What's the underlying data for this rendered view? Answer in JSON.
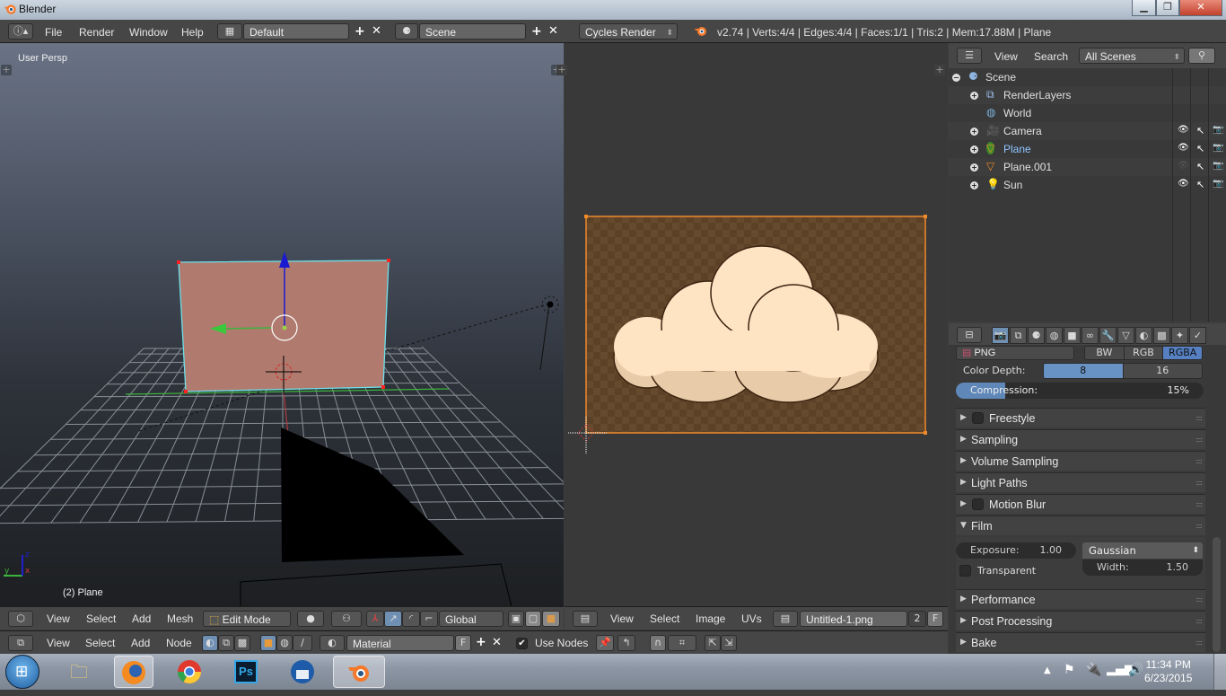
{
  "window": {
    "title": "Blender",
    "minimize_icon": "minimize-icon",
    "restore_icon": "restore-icon",
    "close_icon": "close-icon"
  },
  "info_header": {
    "menus": [
      "File",
      "Render",
      "Window",
      "Help"
    ],
    "screen_layout": "Default",
    "scene": "Scene",
    "render_engine": "Cycles Render",
    "stats": "v2.74 | Verts:4/4 | Edges:4/4 | Faces:1/1 | Tris:2 | Mem:17.88M | Plane"
  },
  "viewport3d": {
    "view_label": "User Persp",
    "object_label": "(2) Plane",
    "axis_labels": {
      "x": "x",
      "y": "y",
      "z": "z"
    },
    "colors": {
      "face": "#b07a6e",
      "edge": "#6ee0e8",
      "vertex": "#ff2020",
      "x_axis": "#c83c3c",
      "y_axis": "#3cb43c",
      "z_axis": "#2020d0"
    },
    "header": {
      "menus": [
        "View",
        "Select",
        "Add",
        "Mesh"
      ],
      "mode": "Edit Mode",
      "transform_orientation": "Global"
    }
  },
  "image_editor": {
    "header": {
      "menus": [
        "View",
        "Select",
        "Image",
        "UVs"
      ],
      "image_name": "Untitled-1.png",
      "users": "2",
      "fake_user": "F"
    },
    "colors": {
      "background": "#5c4127",
      "cloud": "#ffe4c4",
      "cloud_shade": "#e8cba8",
      "outline": "#f08a2a"
    }
  },
  "node_header": {
    "menus": [
      "View",
      "Select",
      "Add",
      "Node"
    ],
    "material": "Material",
    "fake_user": "F",
    "use_nodes_label": "Use Nodes",
    "use_nodes": true
  },
  "outliner": {
    "header": {
      "menus": [
        "View",
        "Search"
      ],
      "display_mode": "All Scenes"
    },
    "items": [
      {
        "name": "Scene",
        "icon": "scene-icon",
        "level": 0
      },
      {
        "name": "RenderLayers",
        "icon": "render-layers-icon",
        "level": 1
      },
      {
        "name": "World",
        "icon": "world-icon",
        "level": 1
      },
      {
        "name": "Camera",
        "icon": "camera-icon",
        "level": 1,
        "visible": true
      },
      {
        "name": "Plane",
        "icon": "mesh-icon",
        "level": 1,
        "visible": true,
        "active": true
      },
      {
        "name": "Plane.001",
        "icon": "mesh-icon",
        "level": 1,
        "visible": false
      },
      {
        "name": "Sun",
        "icon": "lamp-icon",
        "level": 1,
        "visible": true
      }
    ]
  },
  "properties": {
    "tabs": [
      "render",
      "render-layers",
      "scene",
      "world",
      "object",
      "constraints",
      "modifiers",
      "data",
      "material",
      "texture",
      "particles",
      "physics"
    ],
    "file_format": "PNG",
    "color_modes": [
      "BW",
      "RGB",
      "RGBA"
    ],
    "color_mode_selected": "RGBA",
    "color_depth_label": "Color Depth:",
    "color_depths": [
      "8",
      "16"
    ],
    "color_depth_selected": "8",
    "compression_label": "Compression:",
    "compression_value": "15%",
    "compression_fraction": 0.15,
    "panels": [
      {
        "title": "Freestyle",
        "collapsed": true,
        "checkbox": true
      },
      {
        "title": "Sampling",
        "collapsed": true
      },
      {
        "title": "Volume Sampling",
        "collapsed": true
      },
      {
        "title": "Light Paths",
        "collapsed": true
      },
      {
        "title": "Motion Blur",
        "collapsed": true,
        "checkbox": true
      },
      {
        "title": "Film",
        "collapsed": false
      },
      {
        "title": "Performance",
        "collapsed": true
      },
      {
        "title": "Post Processing",
        "collapsed": true
      },
      {
        "title": "Bake",
        "collapsed": true
      }
    ],
    "film": {
      "exposure_label": "Exposure:",
      "exposure_value": "1.00",
      "transparent_label": "Transparent",
      "filter": "Gaussian",
      "width_label": "Width:",
      "width_value": "1.50"
    }
  },
  "taskbar": {
    "apps": [
      "Start",
      "Windows Explorer",
      "Firefox",
      "Chrome",
      "Photoshop",
      "Thunderbird",
      "Blender"
    ],
    "ps_label": "Ps",
    "time": "11:34 PM",
    "date": "6/23/2015"
  }
}
